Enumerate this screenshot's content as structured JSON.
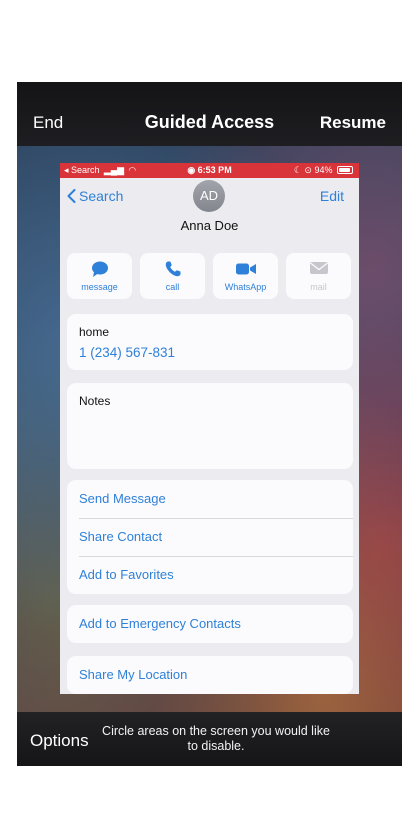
{
  "guided_access": {
    "end_label": "End",
    "title": "Guided Access",
    "resume_label": "Resume",
    "options_label": "Options",
    "hint": "Circle areas on the screen you would like to disable."
  },
  "status_bar": {
    "back_app": "◂ Search",
    "time": "6:53 PM",
    "battery": "94%"
  },
  "contact": {
    "back_label": "Search",
    "edit_label": "Edit",
    "initials": "AD",
    "name": "Anna Doe"
  },
  "actions": [
    {
      "label": "message",
      "icon": "message-icon",
      "enabled": true
    },
    {
      "label": "call",
      "icon": "phone-icon",
      "enabled": true
    },
    {
      "label": "WhatsApp",
      "icon": "video-icon",
      "enabled": true
    },
    {
      "label": "mail",
      "icon": "mail-icon",
      "enabled": false
    }
  ],
  "phone": {
    "label": "home",
    "number": "1 (234) 567-831"
  },
  "notes": {
    "label": "Notes"
  },
  "links": {
    "send_message": "Send Message",
    "share_contact": "Share Contact",
    "add_favorites": "Add to Favorites",
    "add_emergency": "Add to Emergency Contacts",
    "share_location": "Share My Location"
  },
  "colors": {
    "accent": "#2f80d8",
    "status_bar": "#d9343a"
  }
}
